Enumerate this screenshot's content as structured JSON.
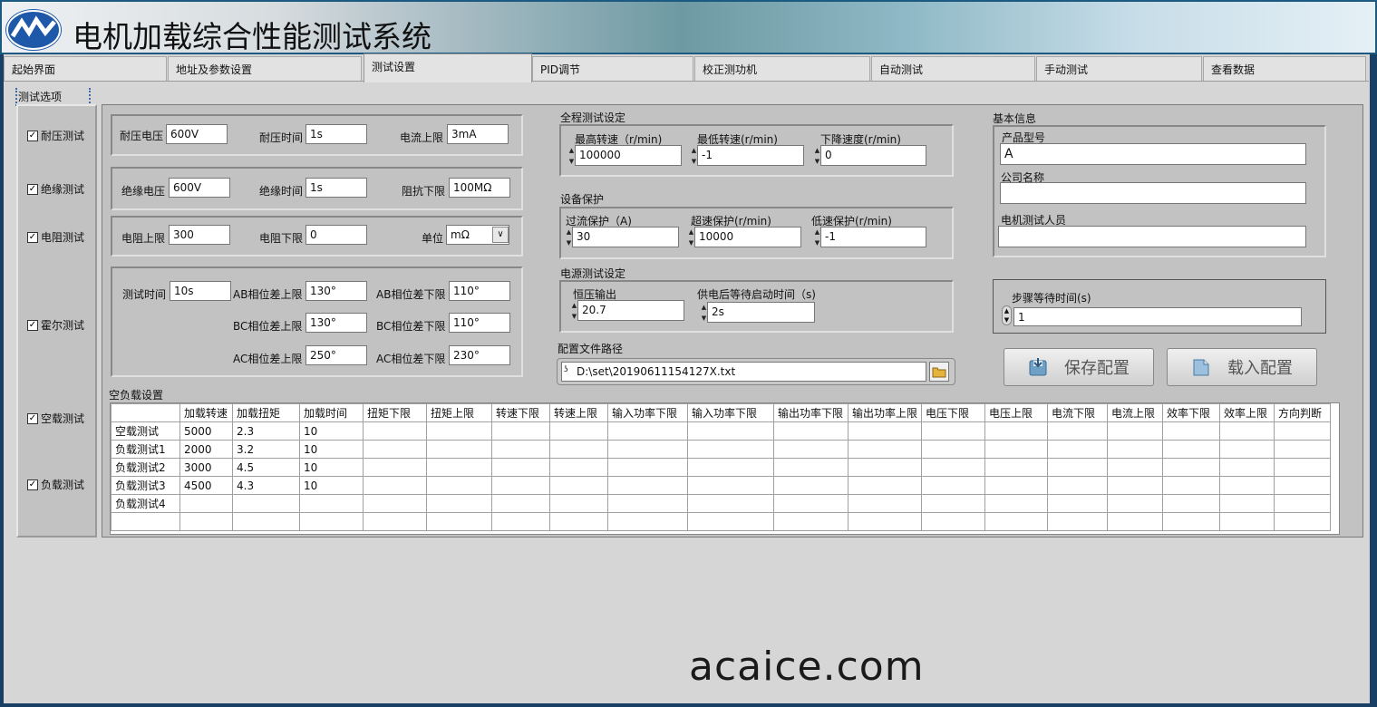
{
  "app": {
    "title": "电机加载综合性能测试系统",
    "logo_icon": "company-logo"
  },
  "tabs": [
    "起始界面",
    "地址及参数设置",
    "测试设置",
    "PID调节",
    "校正测功机",
    "自动测试",
    "手动测试",
    "查看数据"
  ],
  "active_tab": "测试设置",
  "options": {
    "label": "测试选项",
    "items": [
      {
        "label": "耐压测试",
        "checked": true
      },
      {
        "label": "绝缘测试",
        "checked": true
      },
      {
        "label": "电阻测试",
        "checked": true
      },
      {
        "label": "霍尔测试",
        "checked": true
      },
      {
        "label": "空载测试",
        "checked": true
      },
      {
        "label": "负载测试",
        "checked": true
      }
    ]
  },
  "withstand": {
    "voltage_label": "耐压电压",
    "voltage": "600V",
    "time_label": "耐压时间",
    "time": "1s",
    "current_label": "电流上限",
    "current": "3mA"
  },
  "insulation": {
    "voltage_label": "绝缘电压",
    "voltage": "600V",
    "time_label": "绝缘时间",
    "time": "1s",
    "res_label": "阻抗下限",
    "res": "100MΩ"
  },
  "resistance": {
    "upper_label": "电阻上限",
    "upper": "300",
    "lower_label": "电阻下限",
    "lower": "0",
    "unit_label": "单位",
    "unit": "mΩ"
  },
  "hall": {
    "time_label": "测试时间",
    "time": "10s",
    "ab_up_label": "AB相位差上限",
    "ab_up": "130°",
    "ab_low_label": "AB相位差下限",
    "ab_low": "110°",
    "bc_up_label": "BC相位差上限",
    "bc_up": "130°",
    "bc_low_label": "BC相位差下限",
    "bc_low": "110°",
    "ac_up_label": "AC相位差上限",
    "ac_up": "250°",
    "ac_low_label": "AC相位差下限",
    "ac_low": "230°"
  },
  "full_test": {
    "title": "全程测试设定",
    "max_label": "最高转速（r/min)",
    "max": "100000",
    "min_label": "最低转速(r/min)",
    "min": "-1",
    "dec_label": "下降速度(r/min)",
    "dec": "0"
  },
  "protection": {
    "title": "设备保护",
    "over_current_label": "过流保护（A)",
    "over_current": "30",
    "over_speed_label": "超速保护(r/min)",
    "over_speed": "10000",
    "low_speed_label": "低速保护(r/min)",
    "low_speed": "-1"
  },
  "power": {
    "title": "电源测试设定",
    "volt_label": "恒压输出",
    "volt": "20.7",
    "wait_label": "供电后等待启动时间（s)",
    "wait": "2s"
  },
  "config": {
    "path_label": "配置文件路径",
    "path": "D:\\set\\20190611154127X.txt",
    "folder_icon": "folder-open-icon",
    "save_label": "保存配置",
    "load_label": "载入配置",
    "save_icon": "save-icon",
    "load_icon": "load-icon"
  },
  "info": {
    "title": "基本信息",
    "model_label": "产品型号",
    "model": "A",
    "company_label": "公司名称",
    "company": "",
    "tester_label": "电机测试人员",
    "tester": ""
  },
  "step": {
    "label": "步骤等待时间(s)",
    "value": "1"
  },
  "load_table": {
    "title": "空负载设置",
    "headers": [
      "",
      "加载转速",
      "加载扭矩",
      "加载时间",
      "扭矩下限",
      "扭矩上限",
      "转速下限",
      "转速上限",
      "输入功率下限",
      "输入功率下限",
      "输出功率下限",
      "输出功率上限",
      "电压下限",
      "电压上限",
      "电流下限",
      "电流上限",
      "效率下限",
      "效率上限",
      "方向判断"
    ],
    "rows": [
      [
        "空载测试",
        "5000",
        "2.3",
        "10",
        "",
        "",
        "",
        "",
        "",
        "",
        "",
        "",
        "",
        "",
        "",
        "",
        "",
        "",
        ""
      ],
      [
        "负载测试1",
        "2000",
        "3.2",
        "10",
        "",
        "",
        "",
        "",
        "",
        "",
        "",
        "",
        "",
        "",
        "",
        "",
        "",
        "",
        ""
      ],
      [
        "负载测试2",
        "3000",
        "4.5",
        "10",
        "",
        "",
        "",
        "",
        "",
        "",
        "",
        "",
        "",
        "",
        "",
        "",
        "",
        "",
        ""
      ],
      [
        "负载测试3",
        "4500",
        "4.3",
        "10",
        "",
        "",
        "",
        "",
        "",
        "",
        "",
        "",
        "",
        "",
        "",
        "",
        "",
        "",
        ""
      ],
      [
        "负载测试4",
        "",
        "",
        "",
        "",
        "",
        "",
        "",
        "",
        "",
        "",
        "",
        "",
        "",
        "",
        "",
        "",
        "",
        ""
      ],
      [
        "",
        "",
        "",
        "",
        "",
        "",
        "",
        "",
        "",
        "",
        "",
        "",
        "",
        "",
        "",
        "",
        "",
        "",
        ""
      ]
    ]
  },
  "watermark": "acaice.com",
  "colors": {
    "title_bar_border": "#1d5a82",
    "panel": "#c2c2c2",
    "background": "#d6d6d6"
  }
}
